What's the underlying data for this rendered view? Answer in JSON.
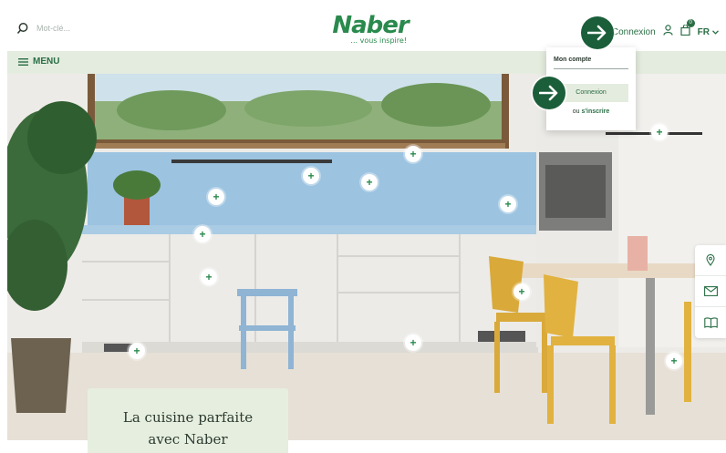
{
  "header": {
    "search_placeholder": "Mot-clé...",
    "logo_word": "Naber",
    "logo_tagline": "... vous inspire!",
    "connexion_label": "Connexion",
    "cart_count": "0",
    "language": "FR"
  },
  "menubar": {
    "menu_label": "MENU"
  },
  "account_menu": {
    "title": "Mon compte",
    "login_label": "Connexion",
    "register_prefix": "ou",
    "register_label": "s'inscrire"
  },
  "hero": {
    "title_line1": "La cuisine parfaite",
    "title_line2": "avec Naber",
    "hotspot_symbol": "+",
    "hotspot_count": 13
  },
  "side_tools": {
    "items": [
      "location-pin-icon",
      "envelope-icon",
      "catalog-book-icon"
    ]
  },
  "colors": {
    "brand_green": "#2a8a4d",
    "dark_green": "#1b5e3a",
    "menu_bar": "#e4ecdf",
    "backsplash_blue": "#9cc3e0"
  }
}
